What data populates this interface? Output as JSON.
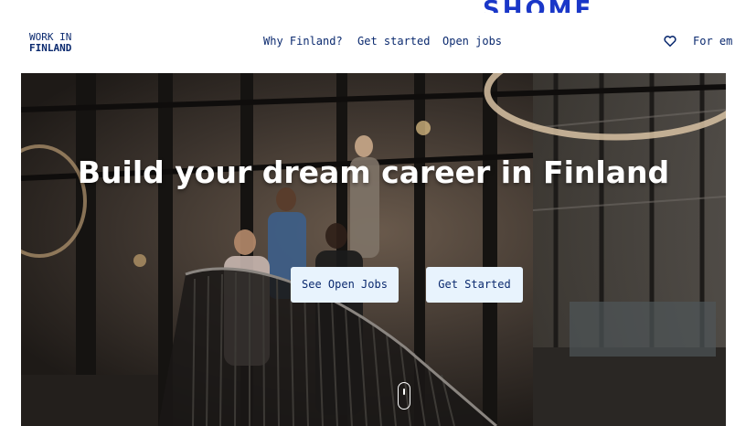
{
  "top_partial_text": "SHOME",
  "header": {
    "logo_line1": "WORK IN",
    "logo_line2": "FINLAND",
    "nav": [
      "Why Finland?",
      "Get started",
      "Open jobs"
    ],
    "employers_label": "For em"
  },
  "hero": {
    "title": "Build your dream career in Finland",
    "primary_button": "See Open Jobs",
    "secondary_button": "Get Started"
  },
  "colors": {
    "brand": "#0b2a6f",
    "button_bg": "#e8f3fd",
    "accent_blue": "#1a37c8"
  }
}
